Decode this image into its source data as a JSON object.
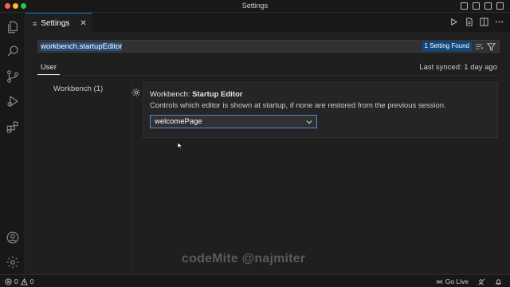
{
  "window": {
    "title": "Settings"
  },
  "colors": {
    "accent": "#0078d4",
    "badge": "#0e4a82",
    "focus_border": "#4d8ae0",
    "close": "#ff5f57",
    "minimize": "#febc2e",
    "maximize": "#28c840"
  },
  "activity_bar": {
    "items": [
      "files-icon",
      "search-icon",
      "source-control-icon",
      "run-debug-icon",
      "extensions-icon"
    ],
    "bottom": [
      "account-icon",
      "manage-gear-icon"
    ]
  },
  "tab": {
    "label": "Settings",
    "close": "✕"
  },
  "search": {
    "value": "workbench.startupEditor",
    "result_badge": "1 Setting Found"
  },
  "scope": {
    "user_tab": "User",
    "last_synced": "Last synced: 1 day ago"
  },
  "toc": {
    "item": "Workbench (1)"
  },
  "setting": {
    "category": "Workbench: ",
    "name": "Startup Editor",
    "description": "Controls which editor is shown at startup, if none are restored from the previous session.",
    "value": "welcomePage"
  },
  "watermark": "codeMite @najmiter",
  "status": {
    "errors": "0",
    "warnings": "0",
    "go_live": "Go Live"
  }
}
